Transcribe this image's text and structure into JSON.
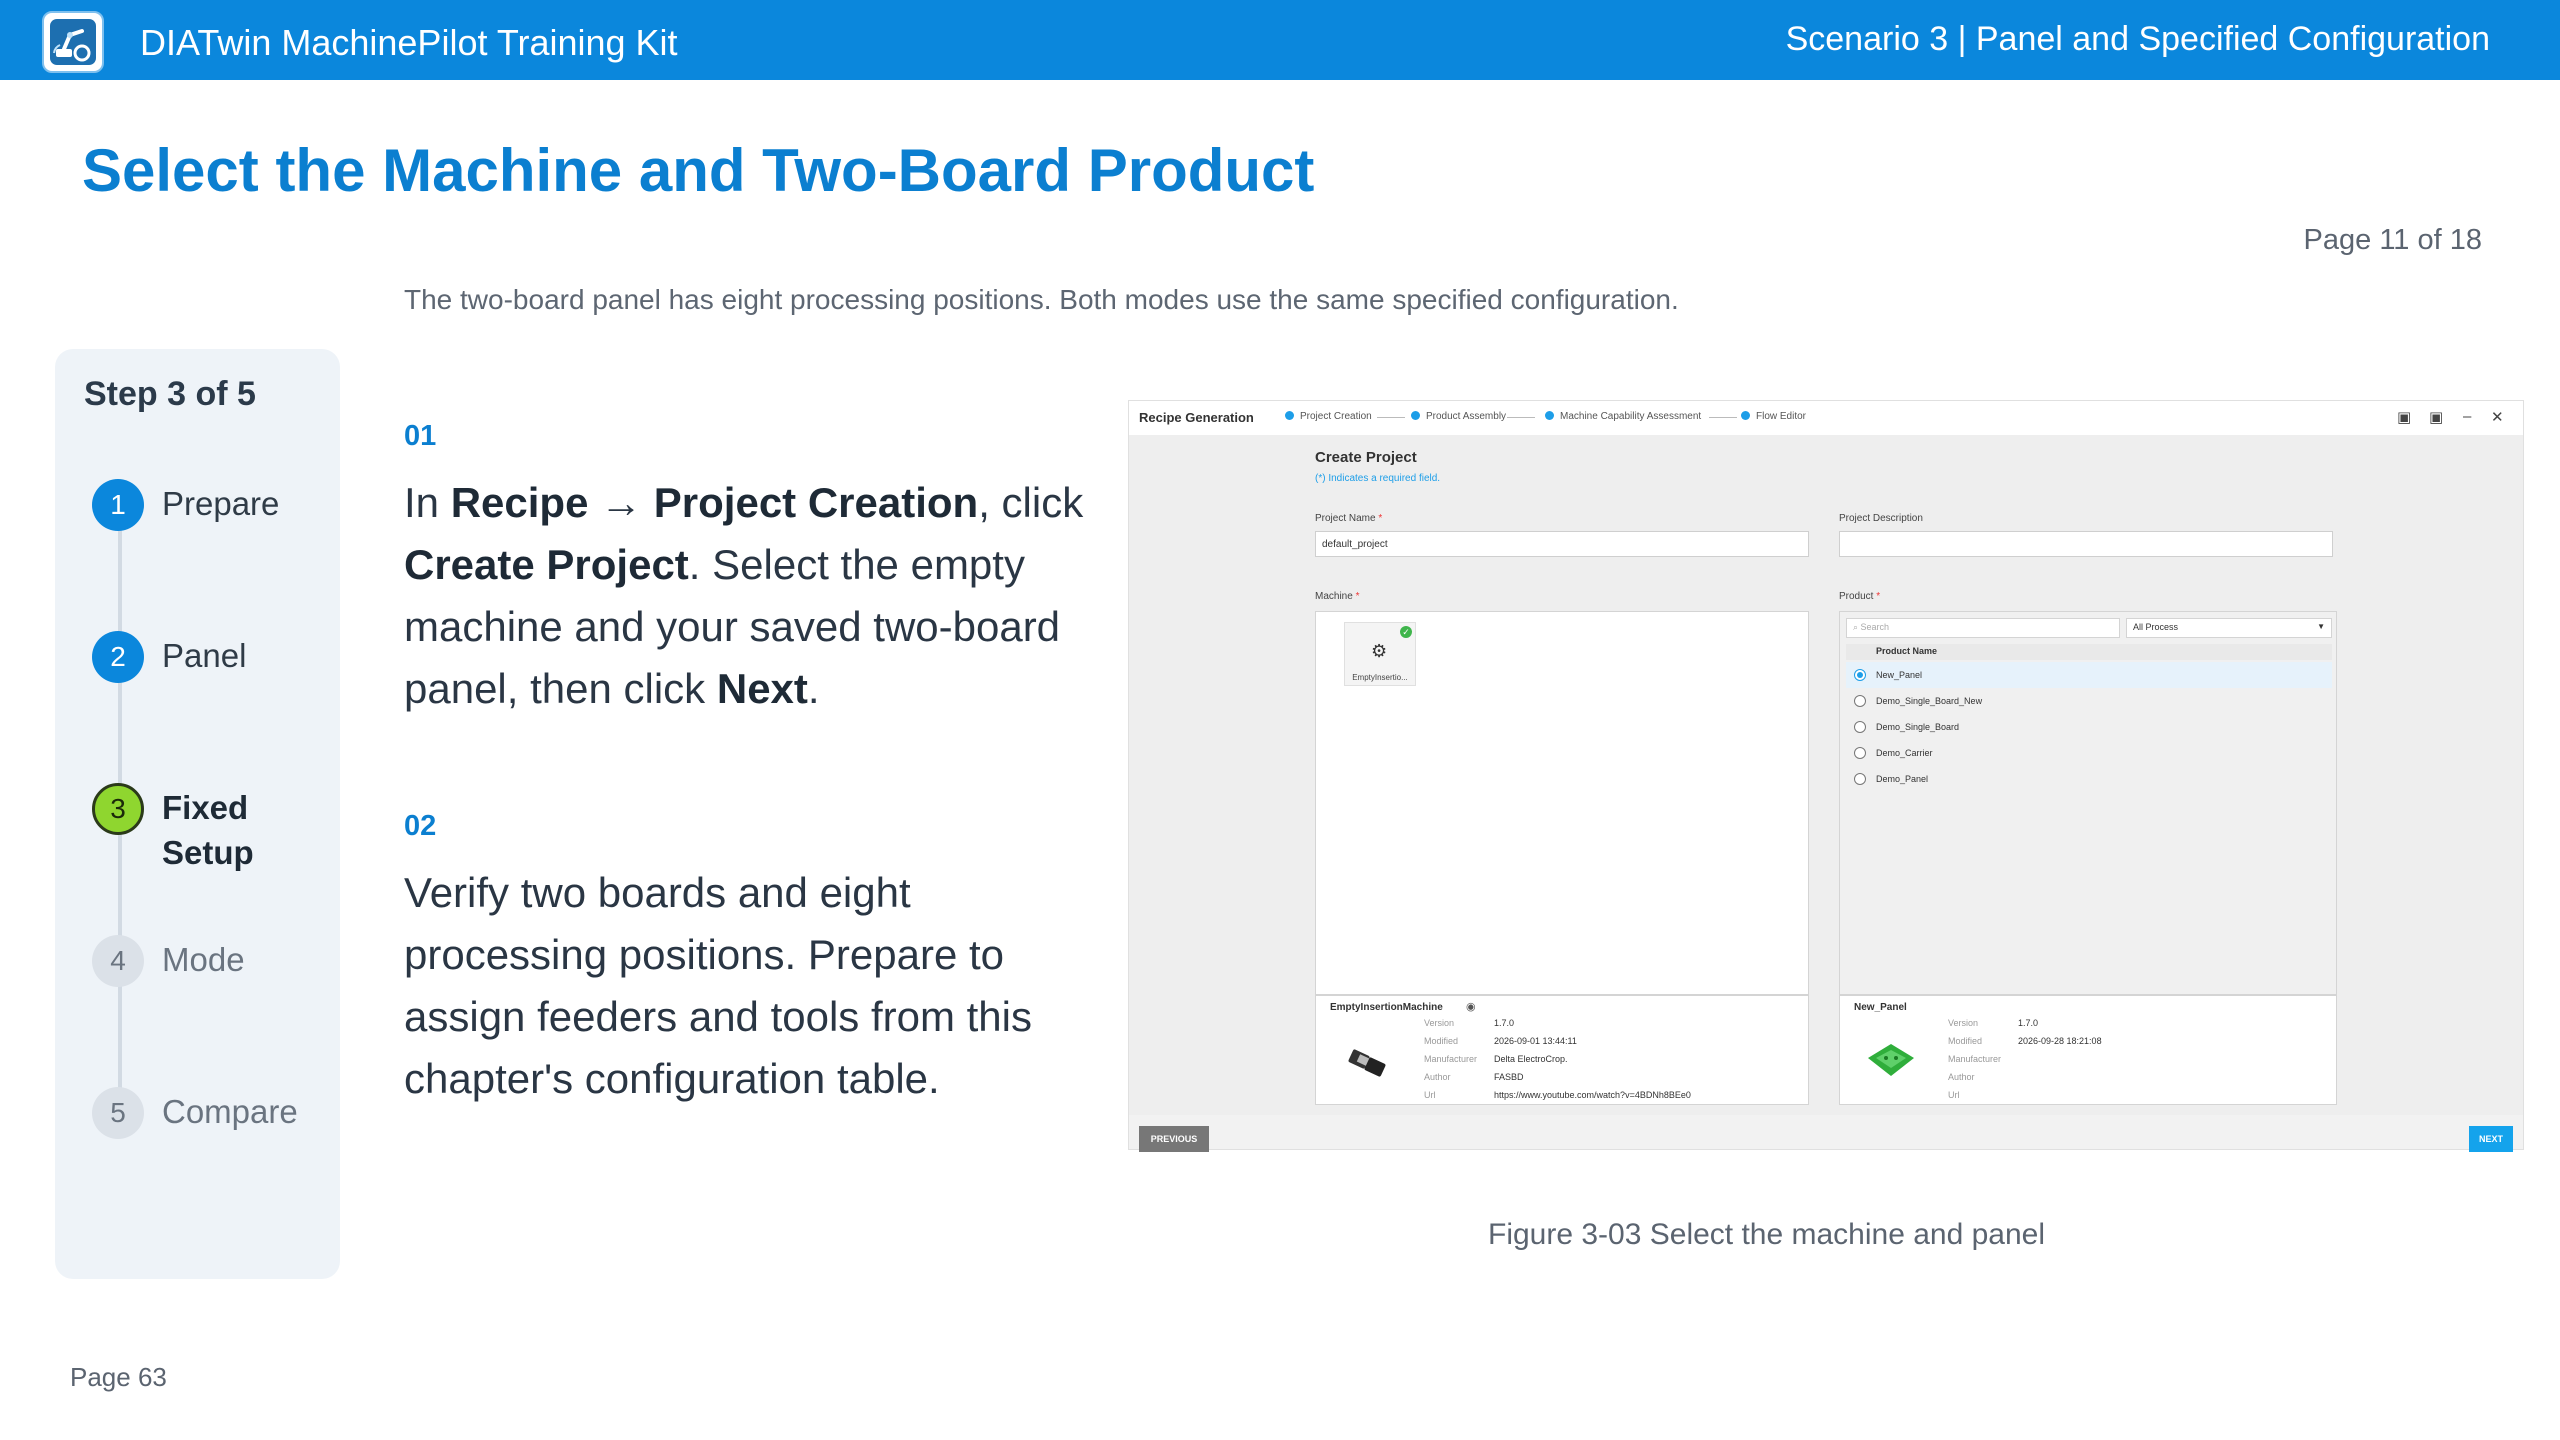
{
  "header": {
    "app_title": "DIATwin MachinePilot Training Kit",
    "scenario": "Scenario 3 | Panel and Specified Configuration",
    "logo_icon": "robot-arm-logo-icon"
  },
  "page": {
    "title": "Select the Machine and Two-Board Product",
    "page_count": "Page 11 of 18",
    "subtitle": "The two-board panel has eight processing positions. Both modes use the same specified configuration.",
    "footer": "Page 63"
  },
  "stepper": {
    "heading": "Step 3 of 5",
    "steps": [
      {
        "num": "1",
        "label": "Prepare",
        "state": "done"
      },
      {
        "num": "2",
        "label": "Panel",
        "state": "done"
      },
      {
        "num": "3",
        "label": "Fixed Setup",
        "label_line1": "Fixed",
        "label_line2": "Setup",
        "state": "current"
      },
      {
        "num": "4",
        "label": "Mode",
        "state": "todo"
      },
      {
        "num": "5",
        "label": "Compare",
        "state": "todo"
      }
    ]
  },
  "instructions": [
    {
      "num": "01",
      "parts": {
        "t1": "In ",
        "b1": "Recipe",
        "t2": " → ",
        "b2": "Project Creation",
        "t3": ", click ",
        "b3": "Create Project",
        "t4": ". Select the empty machine and your saved two-board panel, then click ",
        "b4": "Next",
        "t5": "."
      }
    },
    {
      "num": "02",
      "text": "Verify two boards and eight processing positions. Prepare to assign feeders and tools from this chapter's configuration table."
    }
  ],
  "screenshot": {
    "window_title": "Recipe Generation",
    "steps": [
      "Project Creation",
      "Product Assembly",
      "Machine Capability Assessment",
      "Flow Editor"
    ],
    "create_project": "Create Project",
    "required_note": "(*) Indicates a required field.",
    "project_name_label": "Project Name",
    "project_name_value": "default_project",
    "project_description_label": "Project Description",
    "machine_label": "Machine",
    "machine_tile_name": "EmptyInsertio...",
    "product_label": "Product",
    "search_placeholder": "Search",
    "process_filter": "All Process",
    "product_column": "Product Name",
    "products": [
      "New_Panel",
      "Demo_Single_Board_New",
      "Demo_Single_Board",
      "Demo_Carrier",
      "Demo_Panel"
    ],
    "selected_product_index": 0,
    "machine_info": {
      "name": "EmptyInsertionMachine",
      "version_k": "Version",
      "version": "1.7.0",
      "modified_k": "Modified",
      "modified": "2026-09-01 13:44:11",
      "manufacturer_k": "Manufacturer",
      "manufacturer": "Delta ElectroCrop.",
      "author_k": "Author",
      "author": "FASBD",
      "url_k": "Url",
      "url": "https://www.youtube.com/watch?v=4BDNh8BEe0"
    },
    "product_info": {
      "name": "New_Panel",
      "version_k": "Version",
      "version": "1.7.0",
      "modified_k": "Modified",
      "modified": "2026-09-28 18:21:08",
      "manufacturer_k": "Manufacturer",
      "manufacturer": "",
      "author_k": "Author",
      "author": "",
      "url_k": "Url",
      "url": ""
    },
    "previous_button": "PREVIOUS",
    "next_button": "NEXT"
  },
  "figure_caption": "Figure 3-03  Select the machine and panel",
  "colors": {
    "brand_blue": "#0b87dc",
    "current_step_green": "#8fd62f",
    "accent_link": "#1d9ee8"
  }
}
